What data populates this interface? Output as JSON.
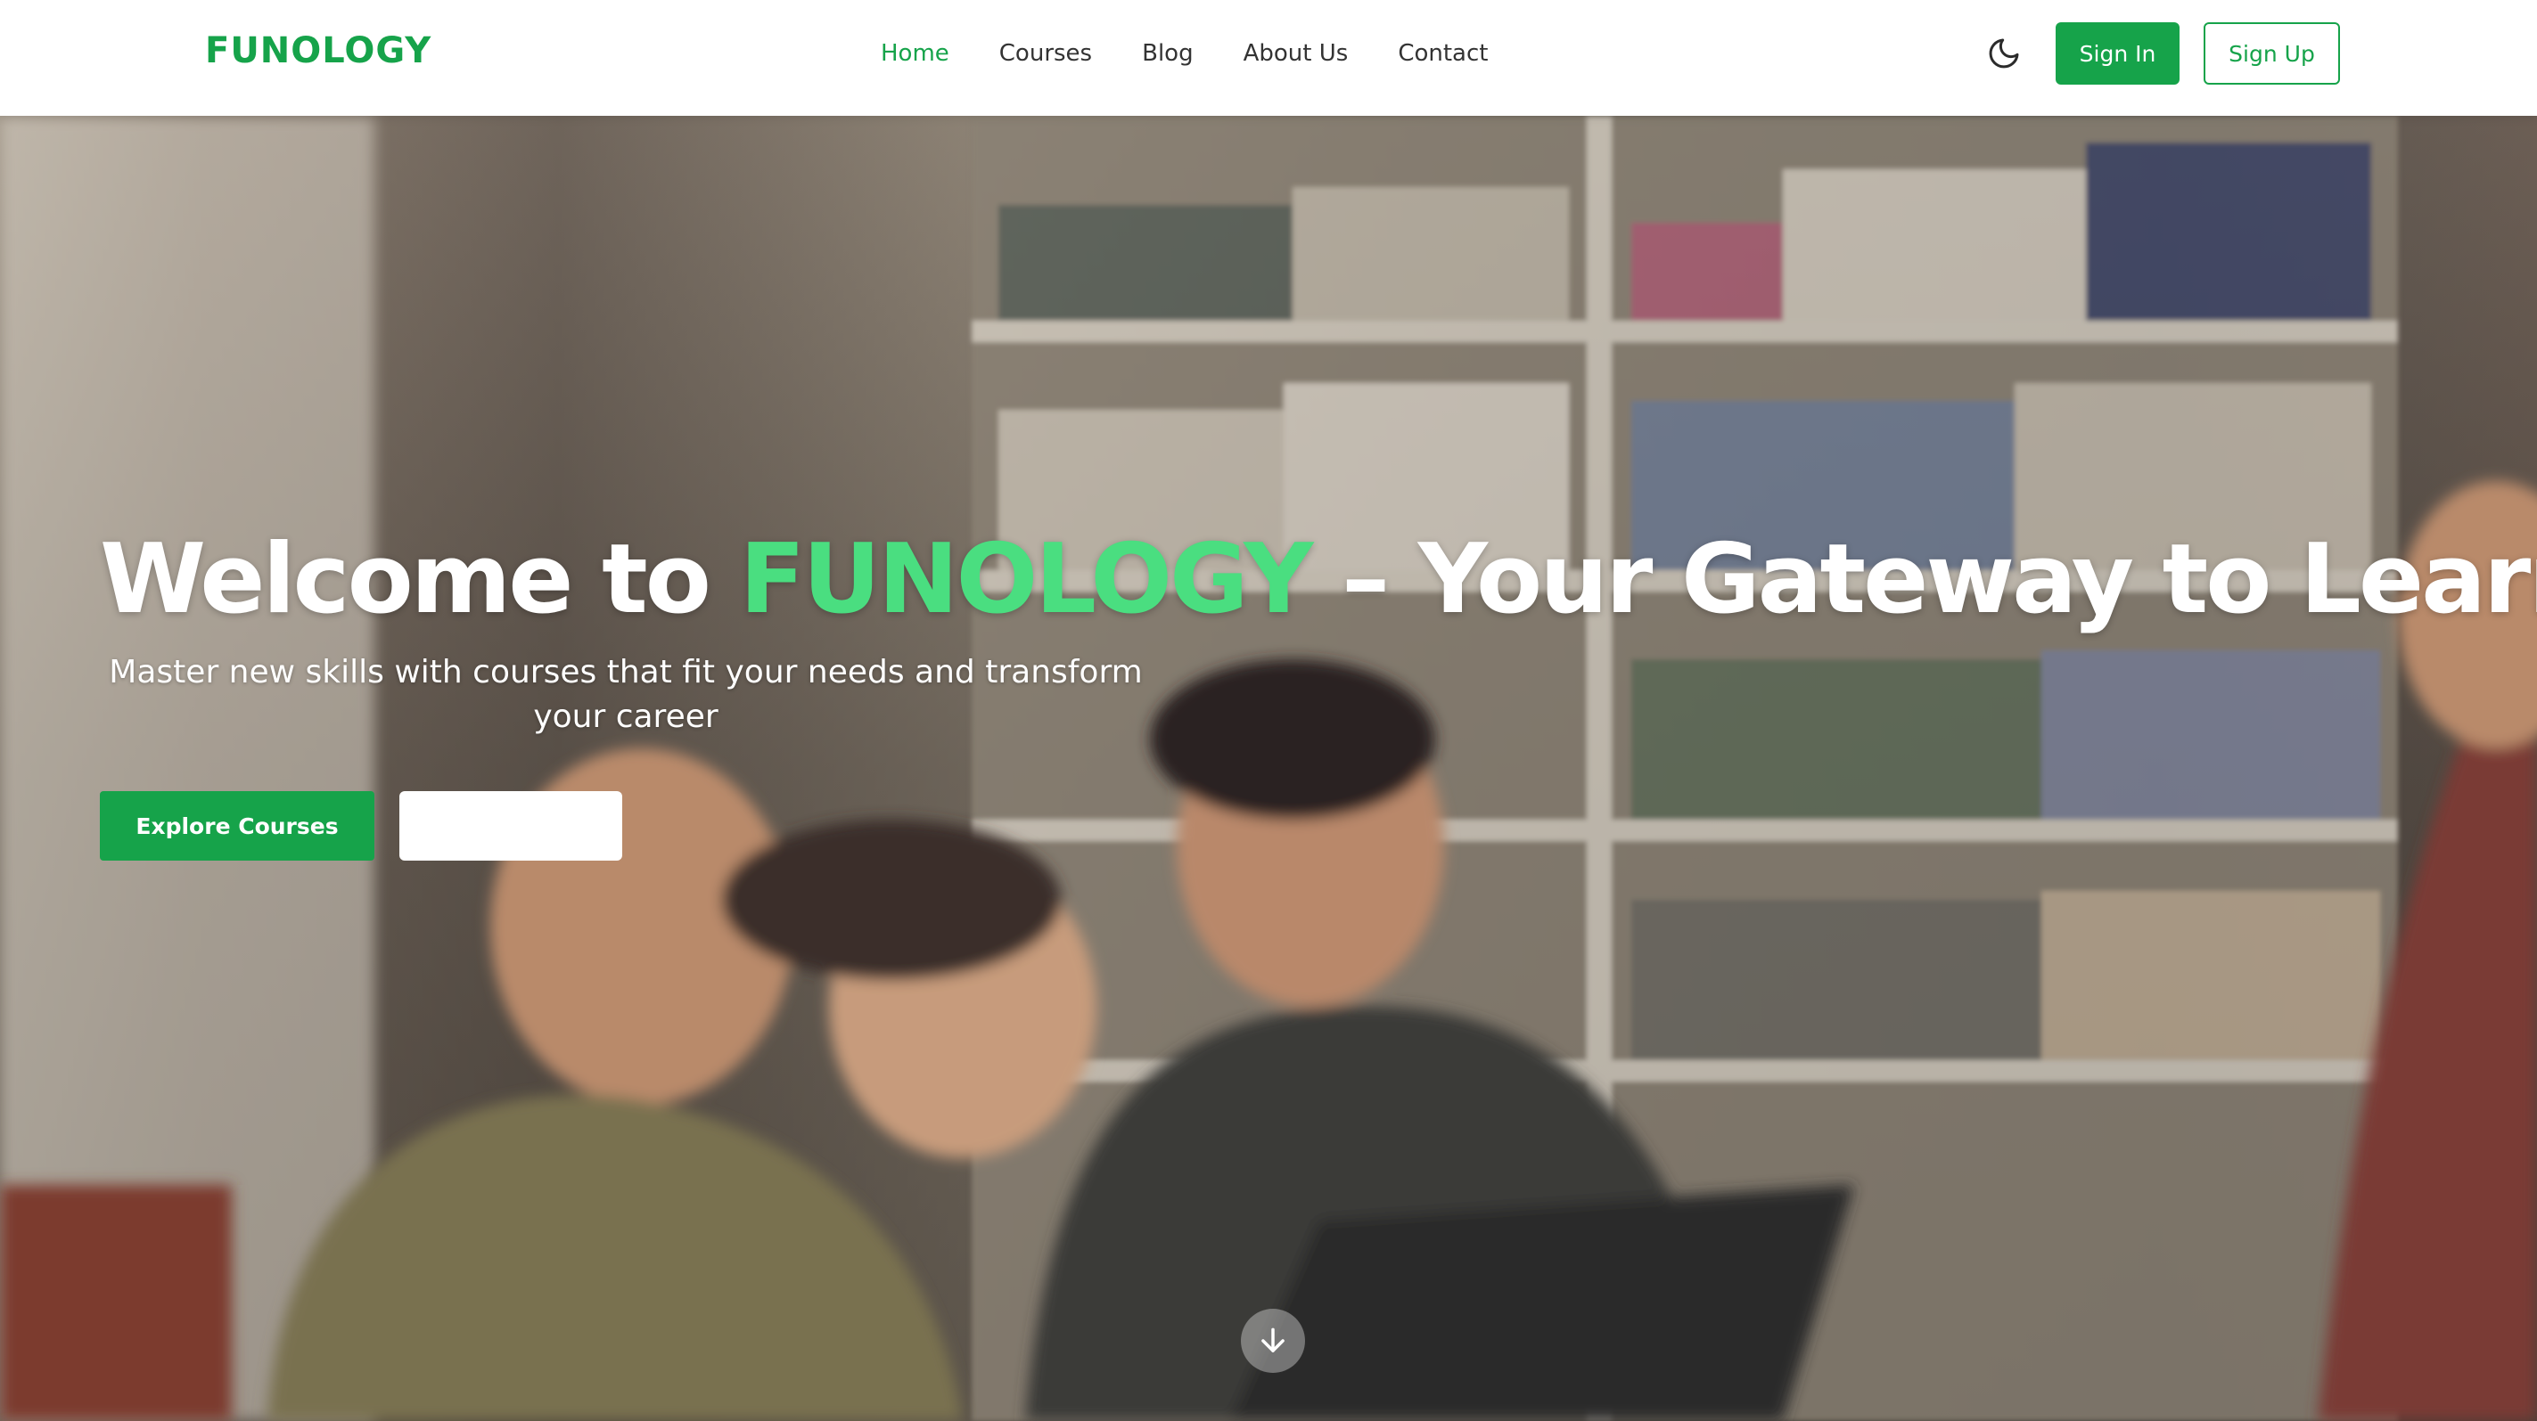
{
  "header": {
    "logo": "FUNOLOGY",
    "nav": [
      {
        "label": "Home",
        "active": true
      },
      {
        "label": "Courses",
        "active": false
      },
      {
        "label": "Blog",
        "active": false
      },
      {
        "label": "About Us",
        "active": false
      },
      {
        "label": "Contact",
        "active": false
      }
    ],
    "theme_toggle_icon": "moon-icon",
    "sign_in_label": "Sign In",
    "sign_up_label": "Sign Up"
  },
  "hero": {
    "title_prefix": "Welcome to ",
    "title_brand": "FUNOLOGY",
    "title_suffix": " – Your Gateway to Learning",
    "subtitle": "Master new skills with courses that fit your needs and transform your career",
    "primary_button": "Explore Courses",
    "secondary_button": "",
    "scroll_icon": "arrow-down-icon",
    "background_image": "students-laughing-library-photo"
  },
  "colors": {
    "brand_green": "#16a34a",
    "title_accent_green": "#4ade80",
    "nav_text": "#333333",
    "white": "#ffffff"
  }
}
